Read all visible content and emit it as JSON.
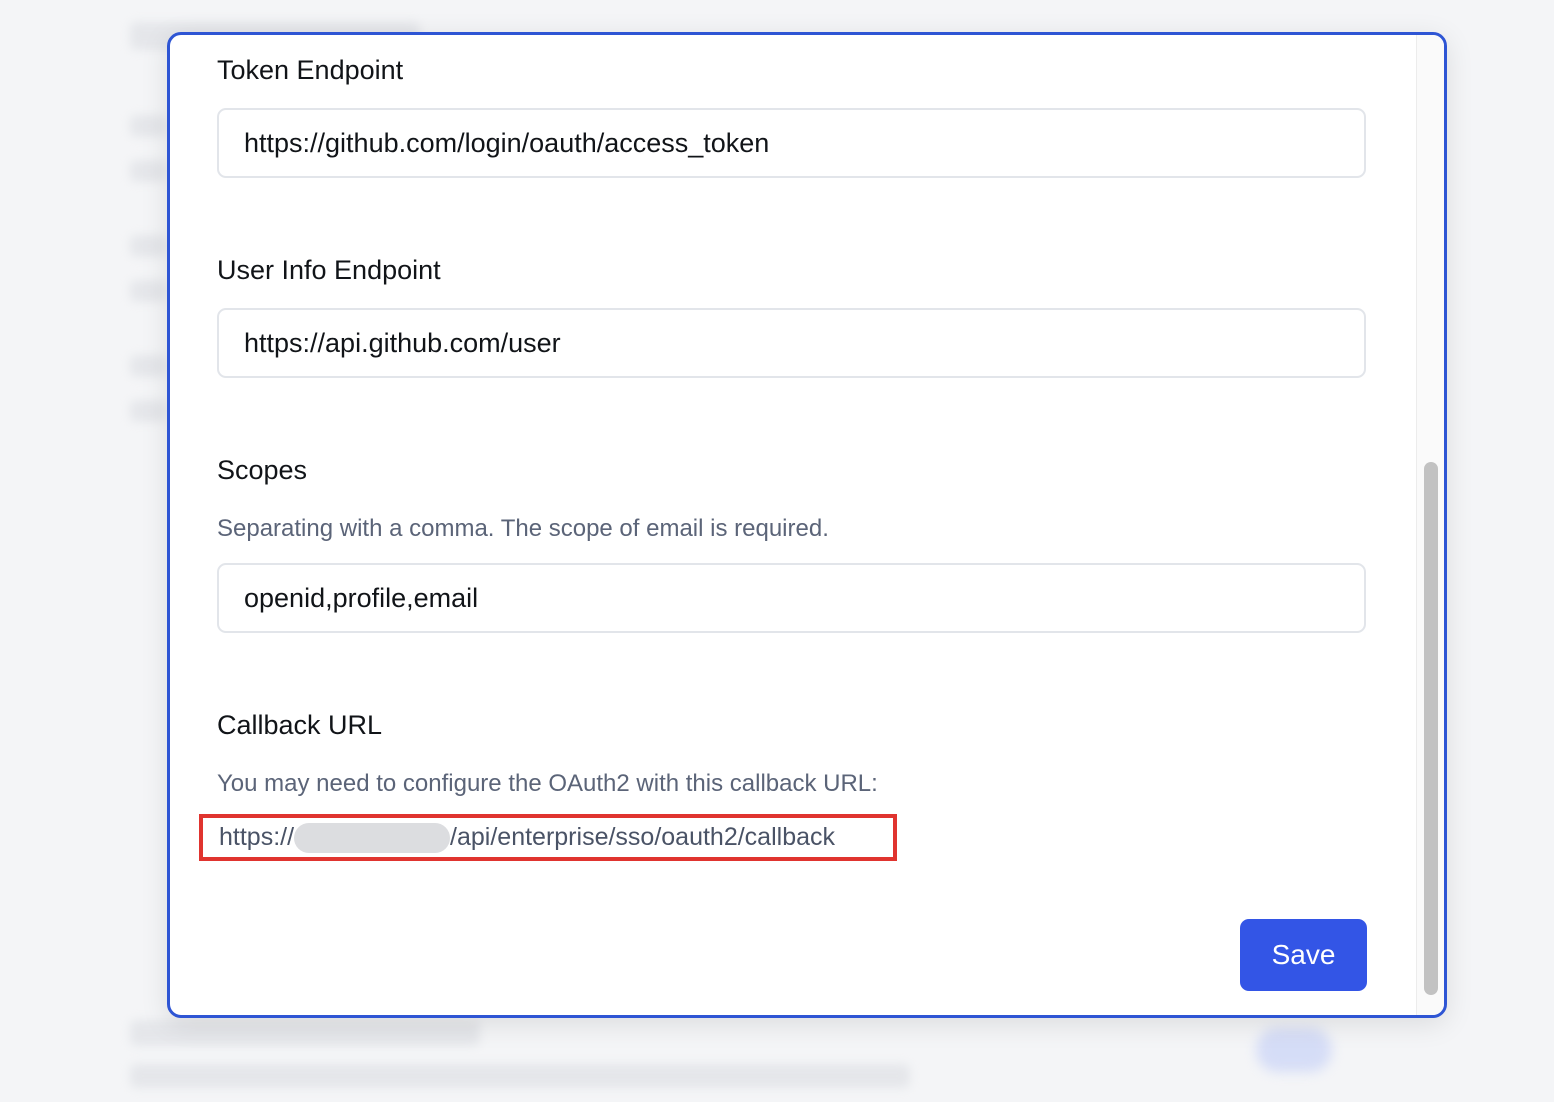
{
  "oauth_form": {
    "token_endpoint": {
      "label": "Token Endpoint",
      "value": "https://github.com/login/oauth/access_token"
    },
    "user_info_endpoint": {
      "label": "User Info Endpoint",
      "value": "https://api.github.com/user"
    },
    "scopes": {
      "label": "Scopes",
      "hint": "Separating with a comma. The scope of email is required.",
      "value": "openid,profile,email"
    },
    "callback_url": {
      "label": "Callback URL",
      "hint": "You may need to configure the OAuth2 with this callback URL:",
      "prefix": "https://",
      "suffix": "/api/enterprise/sso/oauth2/callback"
    },
    "save_label": "Save"
  },
  "colors": {
    "accent": "#3355e6",
    "modal_border": "#2e55d4",
    "highlight_border": "#e0342f",
    "hint_text": "#5b6478"
  },
  "scrollbar": {
    "position_fraction": 0.46
  }
}
